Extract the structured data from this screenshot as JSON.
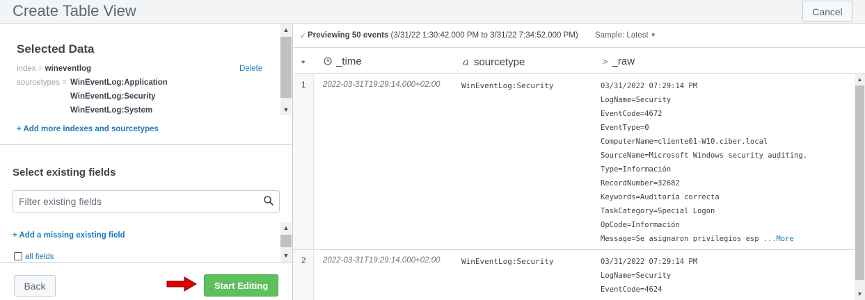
{
  "header": {
    "title": "Create Table View",
    "cancel_label": "Cancel"
  },
  "selected_data": {
    "title": "Selected Data",
    "index_key": "index =",
    "index_value": "wineventlog",
    "delete_label": "Delete",
    "sourcetypes_key": "sourcetypes =",
    "sourcetypes": [
      "WinEventLog:Application",
      "WinEventLog:Security",
      "WinEventLog:System"
    ],
    "add_more_label": "+ Add more indexes and sourcetypes"
  },
  "existing_fields": {
    "title": "Select existing fields",
    "filter_placeholder": "Filter existing fields",
    "add_missing_label": "+ Add a missing existing field",
    "all_fields_label": "all fields"
  },
  "footer": {
    "back_label": "Back",
    "start_label": "Start Editing"
  },
  "preview": {
    "prefix": "Previewing 50 events",
    "range": "(3/31/22 1:30:42.000 PM to 3/31/22 7:34:52.000 PM)",
    "sample_label": "Sample: Latest"
  },
  "table": {
    "col_star": "*",
    "col_time": "_time",
    "col_sourcetype": "sourcetype",
    "col_raw": "_raw",
    "rows": [
      {
        "num": "1",
        "time": "2022-03-31T19:29:14.000+02:00",
        "sourcetype": "WinEventLog:Security",
        "raw": [
          "03/31/2022 07:29:14 PM",
          "LogName=Security",
          "EventCode=4672",
          "EventType=0",
          "ComputerName=cliente01-W10.ciber.local",
          "SourceName=Microsoft Windows security auditing.",
          "Type=Información",
          "RecordNumber=32682",
          "Keywords=Auditoría correcta",
          "TaskCategory=Special Logon",
          "OpCode=Información",
          "Message=Se asignaron privilegios esp"
        ],
        "more_label": "...More"
      },
      {
        "num": "2",
        "time": "2022-03-31T19:29:14.000+02:00",
        "sourcetype": "WinEventLog:Security",
        "raw": [
          "03/31/2022 07:29:14 PM",
          "LogName=Security",
          "EventCode=4624"
        ]
      }
    ]
  },
  "colors": {
    "accent_link": "#1a7bb5",
    "primary_button": "#5cc05c",
    "arrow_annotation": "#e00000"
  }
}
